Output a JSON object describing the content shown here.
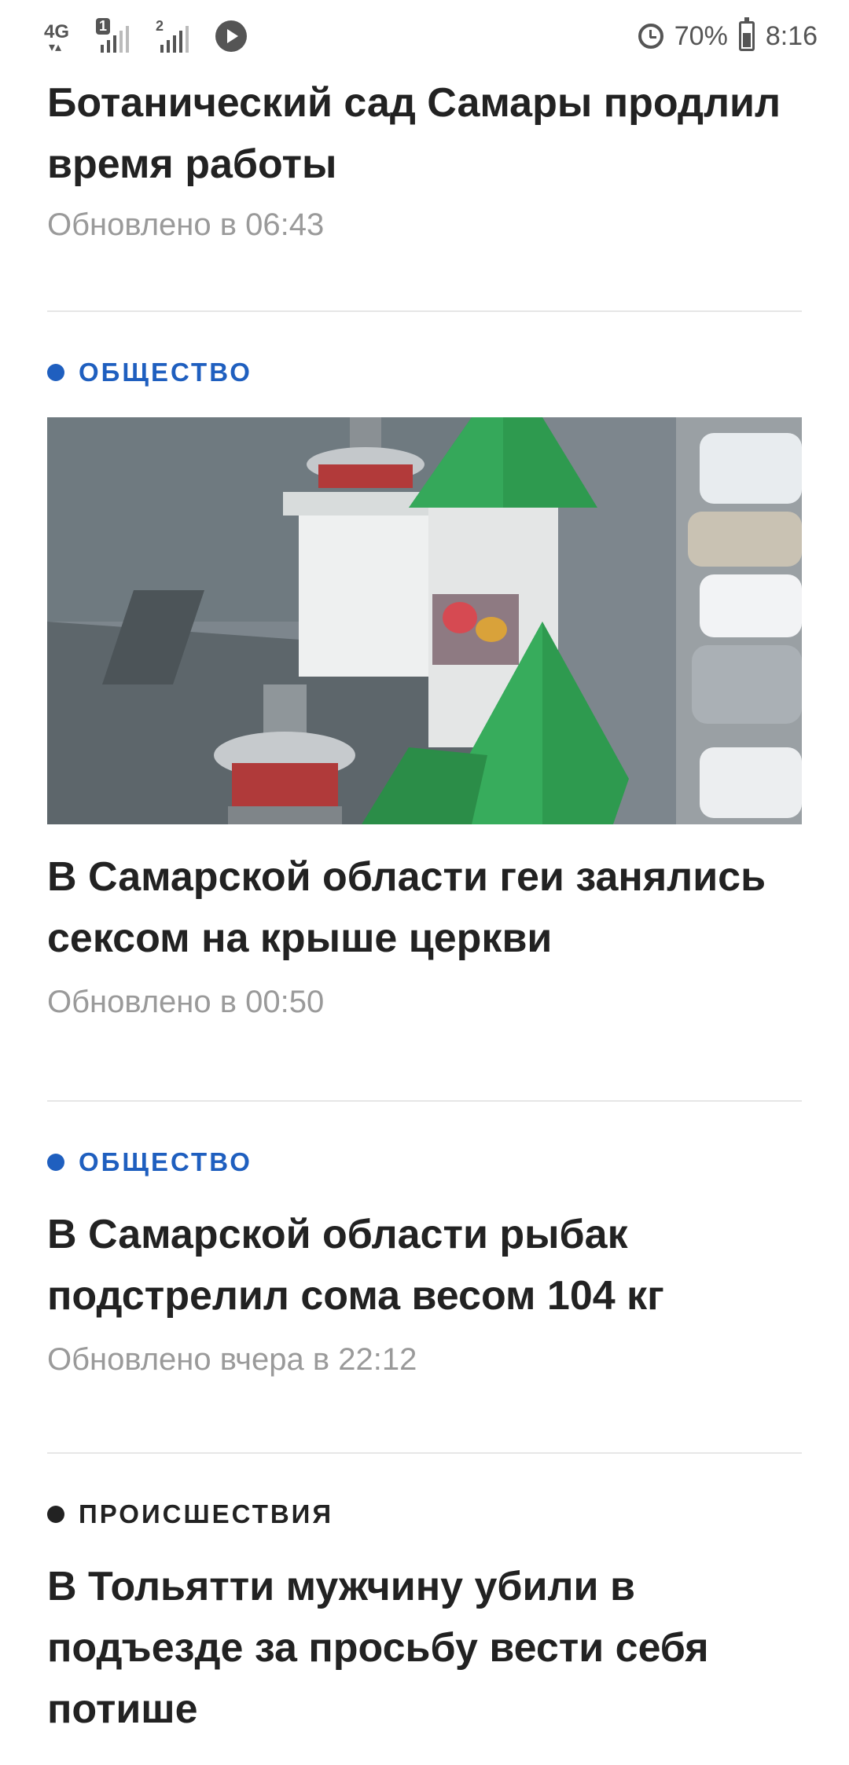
{
  "status_bar": {
    "network_type": "4G",
    "sim1_label": "1",
    "sim2_label": "2",
    "battery_percent": "70%",
    "battery_level": 0.7,
    "time": "8:16",
    "icons": [
      "network-type-icon",
      "signal-sim1-icon",
      "signal-sim2-icon",
      "media-play-icon",
      "alarm-icon",
      "battery-icon"
    ]
  },
  "colors": {
    "category_obshchestvo": "#1f5fbf",
    "category_proisshestviya": "#222222",
    "updated_text": "#9a9a9a",
    "divider": "#e6e6e6"
  },
  "articles": [
    {
      "headline": "Ботанический сад Самары продлил время работы",
      "updated": "Обновлено в 06:43"
    },
    {
      "category": "ОБЩЕСТВО",
      "headline": "В Самарской области геи занялись сексом на крыше церкви",
      "updated": "Обновлено в 00:50"
    },
    {
      "category": "ОБЩЕСТВО",
      "headline": "В Самарской области рыбак подстрелил сома весом 104 кг",
      "updated": "Обновлено вчера в 22:12"
    },
    {
      "category": "ПРОИСШЕСТВИЯ",
      "headline": "В Тольятти мужчину убили в подъезде за просьбу вести себя потише"
    }
  ]
}
